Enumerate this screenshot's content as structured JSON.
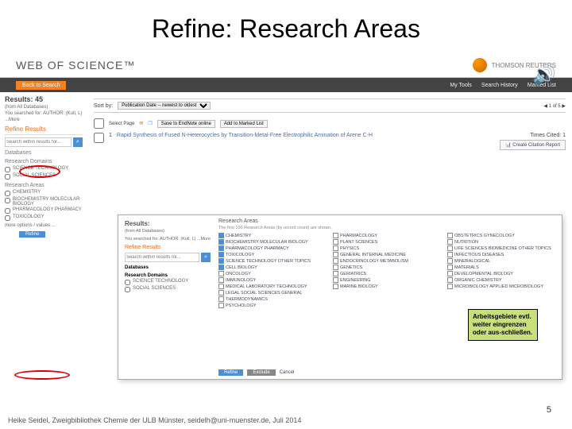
{
  "slide": {
    "title": "Refine: Research Areas",
    "page_num": "5"
  },
  "footer": "Heike Seidel, Zweigbibliothek Chemie der ULB Münster, seidelh@uni-muenster.de, Juli 2014",
  "wos": {
    "logo": "WEB OF SCIENCE™",
    "provider": "THOMSON REUTERS"
  },
  "nav": {
    "back": "Back to Search",
    "tools": "My Tools",
    "history": "Search History",
    "marked": "Marked List"
  },
  "results": {
    "count_lbl": "Results: 45",
    "from": "(from All Databases)",
    "searched": "You searched for: AUTHOR: (Kull, L)",
    "more": "...More",
    "sortlbl": "Sort by:",
    "sortval": "Publication Date -- newest to oldest",
    "selpage": "Select Page",
    "saveto": "Save to EndNote online",
    "addmark": "Add to Marked List",
    "cite": "Create Citation Report",
    "times": "Times Cited: 1",
    "r1": "Rapid Synthesis of Fused N-Heterocycles by Transition-Metal-Free Electrophilic Amination of Arene C-H"
  },
  "sidebar": {
    "refine": "Refine Results",
    "ph": "Search within results for...",
    "db": "Databases",
    "rd": "Research Domains",
    "rd_items": [
      "SCIENCE TECHNOLOGY",
      "SOCIAL SCIENCES"
    ],
    "ra": "Research Areas",
    "ra_items": [
      "CHEMISTRY",
      "BIOCHEMISTRY MOLECULAR BIOLOGY",
      "PHARMACOLOGY PHARMACY",
      "TOXICOLOGY"
    ],
    "more": "more options / values ...",
    "refine_btn": "Refine"
  },
  "overlay": {
    "results_lbl": "Results:",
    "from": "(from All Databases)",
    "searched": "You searched for: AUTHOR: (Kull, L) ...More",
    "refine": "Refine Results",
    "ph": "Search within results for...",
    "db": "Databases",
    "rd": "Research Domains",
    "rd_items": [
      "SCIENCE TECHNOLOGY",
      "SOCIAL SCIENCES"
    ],
    "head": "Research Areas",
    "tip": "The first 100 Research Areas (by record count) are shown.",
    "refine_btn": "Refine",
    "exclude_btn": "Exclude",
    "cancel": "Cancel",
    "col1": [
      "CHEMISTRY",
      "BIOCHEMISTRY MOLECULAR BIOLOGY",
      "PHARMACOLOGY PHARMACY",
      "TOXICOLOGY",
      "SCIENCE TECHNOLOGY OTHER TOPICS",
      "CELL BIOLOGY",
      "ONCOLOGY",
      "IMMUNOLOGY",
      "MEDICAL LABORATORY TECHNOLOGY",
      "LEGAL SOCIAL SCIENCES GENERAL",
      "THERMODYNAMICS",
      "PSYCHOLOGY"
    ],
    "col2": [
      "PHARMACOLOGY",
      "PLANT SCIENCES",
      "PHYSICS",
      "GENERAL INTERNAL MEDICINE",
      "ENDOCRINOLOGY METABOLISM",
      "GENETICS",
      "GERIATRICS",
      "ENGINEERING",
      "MARINE BIOLOGY"
    ],
    "col3": [
      "OBSTETRICS GYNECOLOGY",
      "NUTRITION",
      "LIFE SCIENCES BIOMEDICINE OTHER TOPICS",
      "INFECTIOUS DISEASES",
      "MINERALOGICAL",
      "MATERIALS",
      "DEVELOPMENTAL BIOLOGY",
      "ORGANIC CHEMISTRY",
      "MICROBIOLOGY APPLIED MICROBIOLOGY"
    ]
  },
  "note": "Arbeitsgebiete evtl. weiter eingrenzen oder aus-schließen."
}
